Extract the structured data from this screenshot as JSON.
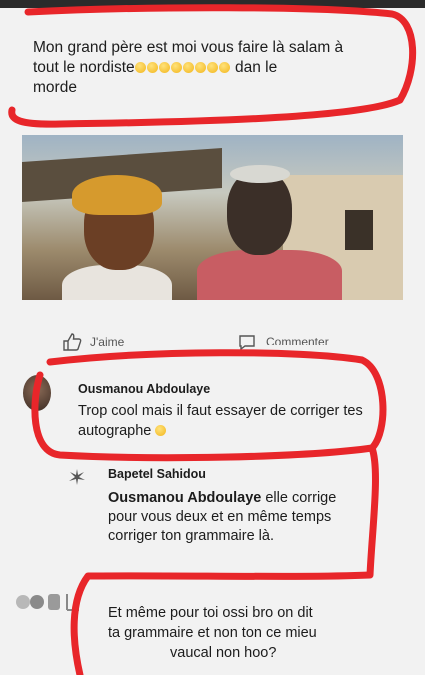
{
  "post": {
    "line1": "Mon grand père est moi vous faire là salam à",
    "line2_prefix": "tout le nordiste",
    "line2_suffix": " dan le",
    "line3": "morde",
    "emoji_count": 8,
    "emoji_icon": "laughing-emoji-icon"
  },
  "actions": {
    "like_label": "J'aime",
    "comment_label": "Commenter",
    "like_icon": "thumbs-up-icon",
    "comment_icon": "speech-bubble-icon"
  },
  "comments": [
    {
      "author": "Ousmanou Abdoulaye",
      "text": "Trop cool mais il faut essayer de corriger tes autographe"
    },
    {
      "author": "Bapetel Sahidou",
      "mention": "Ousmanou Abdoulaye",
      "text": " elle corrige pour vous deux et en même temps corriger ton grammaire là."
    },
    {
      "line1": "Et même pour toi ossi bro on dit",
      "line2": "ta grammaire et non ton ce mieu",
      "line3": "vaucal non hoo?"
    }
  ],
  "colors": {
    "annotation": "#e8262a",
    "background": "#f2f2f2"
  }
}
